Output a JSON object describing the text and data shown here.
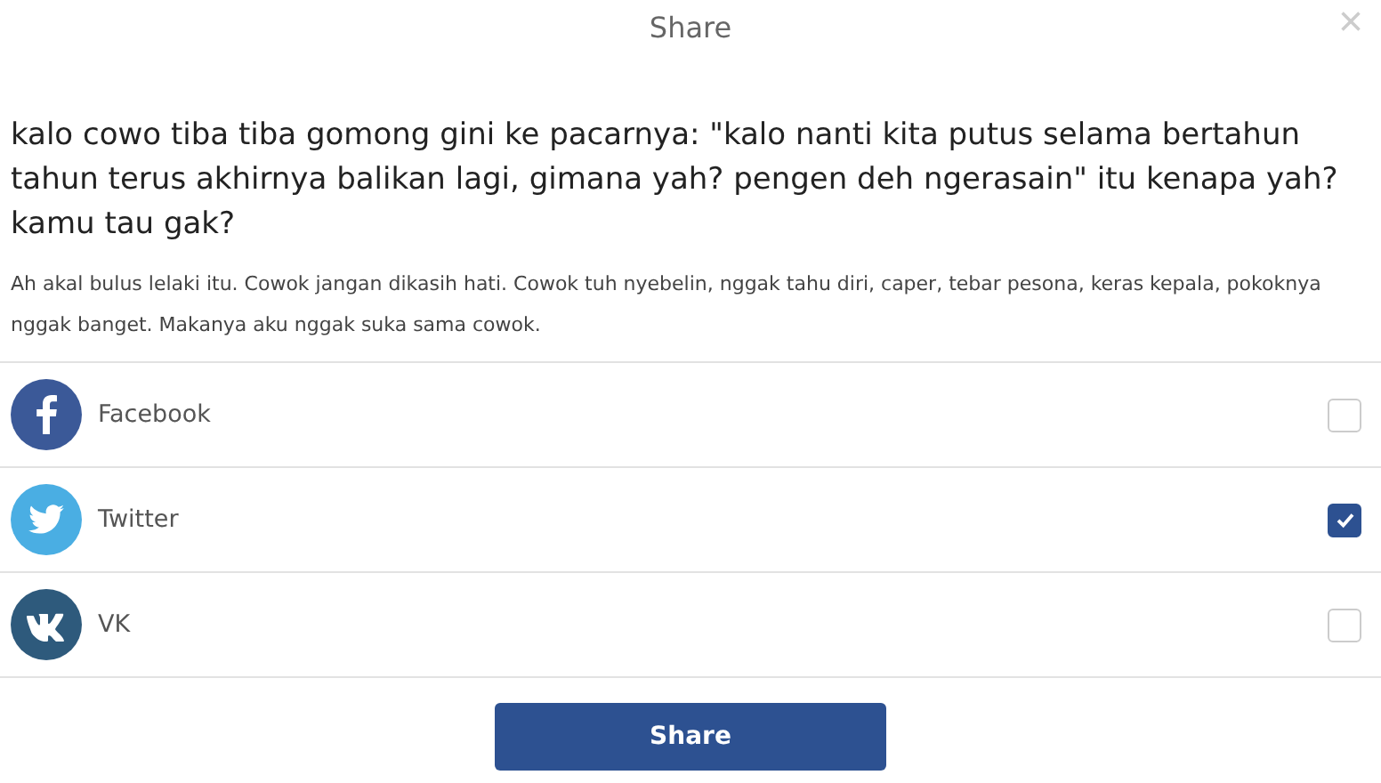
{
  "dialog": {
    "title": "Share",
    "close": "×"
  },
  "question": "kalo cowo tiba tiba gomong gini ke pacarnya: \"kalo nanti kita putus selama bertahun tahun terus akhirnya balikan lagi, gimana yah? pengen deh ngerasain\" itu kenapa yah? kamu tau gak?",
  "answer": "Ah akal bulus lelaki itu. Cowok jangan dikasih hati. Cowok tuh nyebelin, nggak tahu diri, caper, tebar pesona, keras kepala, pokoknya nggak banget. Makanya aku nggak suka sama cowok.",
  "networks": [
    {
      "kind": "facebook",
      "label": "Facebook",
      "color": "#3b5998",
      "checked": false
    },
    {
      "kind": "twitter",
      "label": "Twitter",
      "color": "#4aaee3",
      "checked": true
    },
    {
      "kind": "vk",
      "label": "VK",
      "color": "#2e5a7c",
      "checked": false
    }
  ],
  "share_button": "Share"
}
